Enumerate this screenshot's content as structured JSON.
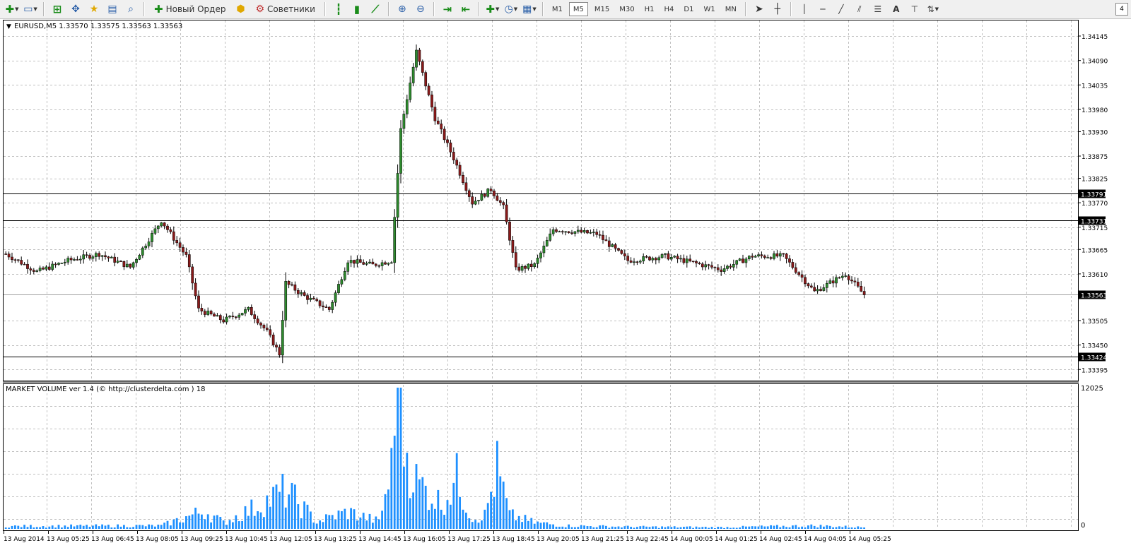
{
  "toolbar": {
    "new_order_label": "Новый Ордер",
    "advisors_label": "Советники",
    "timeframes": [
      "M1",
      "M5",
      "M15",
      "M30",
      "H1",
      "H4",
      "D1",
      "W1",
      "MN"
    ],
    "active_timeframe": "M5",
    "corner_badge": "4"
  },
  "main_chart": {
    "header": "EURUSD,M5  1.33570 1.33575 1.33563 1.33563",
    "ylim": [
      1.3337,
      1.3418
    ],
    "price_ticks": [
      "1.34145",
      "1.34090",
      "1.34035",
      "1.33980",
      "1.33930",
      "1.33875",
      "1.33825",
      "1.33770",
      "1.33715",
      "1.33665",
      "1.33610",
      "1.33505",
      "1.33450",
      "1.33395"
    ],
    "hlines": [
      {
        "label": "1.33791",
        "value": 1.33791,
        "style": "solid"
      },
      {
        "label": "1.33731",
        "value": 1.33731,
        "style": "solid"
      },
      {
        "label": "1.33424",
        "value": 1.33424,
        "style": "solid"
      },
      {
        "label": "1.33563",
        "value": 1.33563,
        "style": "current"
      }
    ]
  },
  "volume_panel": {
    "header": "MARKET VOLUME ver 1.4 (© http://clusterdelta.com ) 18",
    "max_label": "12025",
    "min_label": "0",
    "ymax": 12025
  },
  "time_axis": {
    "labels": [
      "13 Aug 2014",
      "13 Aug 05:25",
      "13 Aug 06:45",
      "13 Aug 08:05",
      "13 Aug 09:25",
      "13 Aug 10:45",
      "13 Aug 12:05",
      "13 Aug 13:25",
      "13 Aug 14:45",
      "13 Aug 16:05",
      "13 Aug 17:25",
      "13 Aug 18:45",
      "13 Aug 20:05",
      "13 Aug 21:25",
      "13 Aug 22:45",
      "14 Aug 00:05",
      "14 Aug 01:25",
      "14 Aug 02:45",
      "14 Aug 04:05",
      "14 Aug 05:25"
    ]
  },
  "colors": {
    "bull": "#2e8b2e",
    "bear": "#8b1a1a",
    "volume": "#1e90ff",
    "grid": "#c0c0c0"
  },
  "chart_data": {
    "type": "candlestick",
    "instrument": "EURUSD",
    "timeframe": "M5",
    "anchors": [
      {
        "bar": 0,
        "price": 1.33655
      },
      {
        "bar": 10,
        "price": 1.33615
      },
      {
        "bar": 20,
        "price": 1.3364
      },
      {
        "bar": 30,
        "price": 1.33655
      },
      {
        "bar": 40,
        "price": 1.33625
      },
      {
        "bar": 50,
        "price": 1.3373
      },
      {
        "bar": 58,
        "price": 1.3365
      },
      {
        "bar": 62,
        "price": 1.3353
      },
      {
        "bar": 70,
        "price": 1.33505
      },
      {
        "bar": 78,
        "price": 1.3353
      },
      {
        "bar": 84,
        "price": 1.3348
      },
      {
        "bar": 88,
        "price": 1.3343
      },
      {
        "bar": 90,
        "price": 1.3359
      },
      {
        "bar": 96,
        "price": 1.3356
      },
      {
        "bar": 104,
        "price": 1.3353
      },
      {
        "bar": 110,
        "price": 1.3364
      },
      {
        "bar": 118,
        "price": 1.3363
      },
      {
        "bar": 124,
        "price": 1.3364
      },
      {
        "bar": 127,
        "price": 1.33935
      },
      {
        "bar": 132,
        "price": 1.3411
      },
      {
        "bar": 138,
        "price": 1.3396
      },
      {
        "bar": 144,
        "price": 1.3387
      },
      {
        "bar": 150,
        "price": 1.3377
      },
      {
        "bar": 156,
        "price": 1.338
      },
      {
        "bar": 160,
        "price": 1.3376
      },
      {
        "bar": 164,
        "price": 1.3362
      },
      {
        "bar": 170,
        "price": 1.3363
      },
      {
        "bar": 176,
        "price": 1.3371
      },
      {
        "bar": 190,
        "price": 1.337
      },
      {
        "bar": 200,
        "price": 1.3364
      },
      {
        "bar": 212,
        "price": 1.3365
      },
      {
        "bar": 230,
        "price": 1.3362
      },
      {
        "bar": 240,
        "price": 1.3365
      },
      {
        "bar": 250,
        "price": 1.3365
      },
      {
        "bar": 260,
        "price": 1.3357
      },
      {
        "bar": 270,
        "price": 1.3361
      },
      {
        "bar": 276,
        "price": 1.33563
      }
    ],
    "volume_anchors": [
      {
        "bar": 0,
        "value": 250
      },
      {
        "bar": 50,
        "value": 300
      },
      {
        "bar": 64,
        "value": 1700
      },
      {
        "bar": 70,
        "value": 600
      },
      {
        "bar": 80,
        "value": 2000
      },
      {
        "bar": 90,
        "value": 3600
      },
      {
        "bar": 100,
        "value": 700
      },
      {
        "bar": 110,
        "value": 1600
      },
      {
        "bar": 120,
        "value": 700
      },
      {
        "bar": 124,
        "value": 5600
      },
      {
        "bar": 126,
        "value": 12025
      },
      {
        "bar": 128,
        "value": 8300
      },
      {
        "bar": 132,
        "value": 4500
      },
      {
        "bar": 140,
        "value": 2400
      },
      {
        "bar": 145,
        "value": 4700
      },
      {
        "bar": 150,
        "value": 1000
      },
      {
        "bar": 154,
        "value": 1300
      },
      {
        "bar": 158,
        "value": 5600
      },
      {
        "bar": 162,
        "value": 1300
      },
      {
        "bar": 170,
        "value": 600
      },
      {
        "bar": 180,
        "value": 300
      },
      {
        "bar": 200,
        "value": 200
      },
      {
        "bar": 230,
        "value": 150
      },
      {
        "bar": 260,
        "value": 300
      },
      {
        "bar": 276,
        "value": 150
      }
    ]
  }
}
